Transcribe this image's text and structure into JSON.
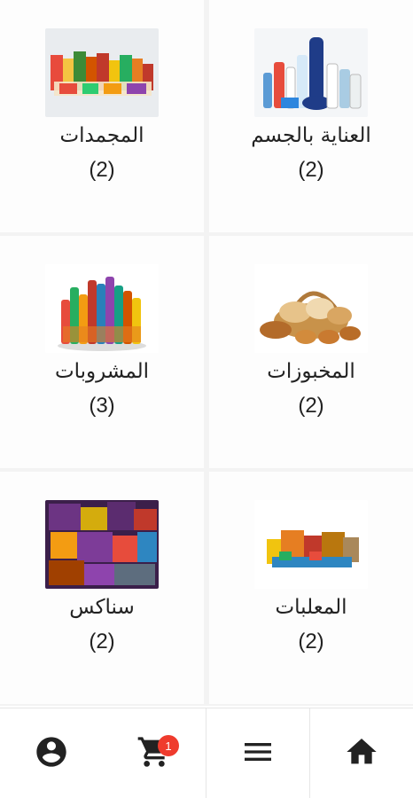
{
  "categories": [
    {
      "name": "المجمدات",
      "count": "(2)",
      "image": "frozen-foods-image"
    },
    {
      "name": "العناية بالجسم",
      "count": "(2)",
      "image": "body-care-image"
    },
    {
      "name": "المشروبات",
      "count": "(3)",
      "image": "beverages-image"
    },
    {
      "name": "المخبوزات",
      "count": "(2)",
      "image": "bakery-image"
    },
    {
      "name": "سناكس",
      "count": "(2)",
      "image": "snacks-image"
    },
    {
      "name": "المعلبات",
      "count": "(2)",
      "image": "canned-goods-image"
    }
  ],
  "bottom_nav": {
    "items": [
      {
        "icon": "account-circle-icon"
      },
      {
        "icon": "cart-icon",
        "badge": "1"
      },
      {
        "icon": "menu-icon"
      },
      {
        "icon": "home-icon"
      }
    ]
  },
  "colors": {
    "badge": "#ef3b2d",
    "icon": "#222222",
    "grid_gap": "#f3f3f3"
  }
}
